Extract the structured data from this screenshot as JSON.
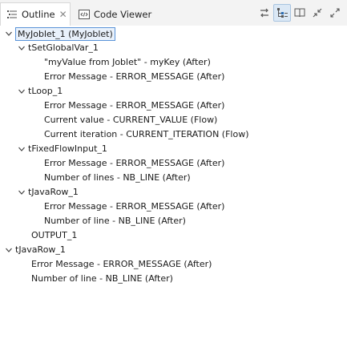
{
  "tabs": {
    "outline": {
      "label": "Outline",
      "close": "✕"
    },
    "code_viewer": {
      "label": "Code Viewer"
    }
  },
  "toolbar": {
    "buttons": [
      "sync-arrows-icon",
      "hierarchy-tree-icon",
      "book-icon",
      "minimize-icon",
      "maximize-icon"
    ]
  },
  "tree": {
    "root": "MyJoblet_1 (MyJoblet)",
    "tSetGlobalVar": {
      "label": "tSetGlobalVar_1",
      "children": [
        "\"myValue from Joblet\" - myKey (After)",
        "Error Message - ERROR_MESSAGE (After)"
      ]
    },
    "tLoop": {
      "label": "tLoop_1",
      "children": [
        "Error Message - ERROR_MESSAGE (After)",
        "Current value - CURRENT_VALUE (Flow)",
        "Current iteration - CURRENT_ITERATION (Flow)"
      ]
    },
    "tFixedFlowInput": {
      "label": "tFixedFlowInput_1",
      "children": [
        "Error Message - ERROR_MESSAGE (After)",
        "Number of lines - NB_LINE (After)"
      ]
    },
    "tJavaRowInner": {
      "label": "tJavaRow_1",
      "children": [
        "Error Message - ERROR_MESSAGE (After)",
        "Number of line - NB_LINE (After)"
      ]
    },
    "output": "OUTPUT_1",
    "tJavaRowOuter": {
      "label": "tJavaRow_1",
      "children": [
        "Error Message - ERROR_MESSAGE (After)",
        "Number of line - NB_LINE (After)"
      ]
    }
  }
}
